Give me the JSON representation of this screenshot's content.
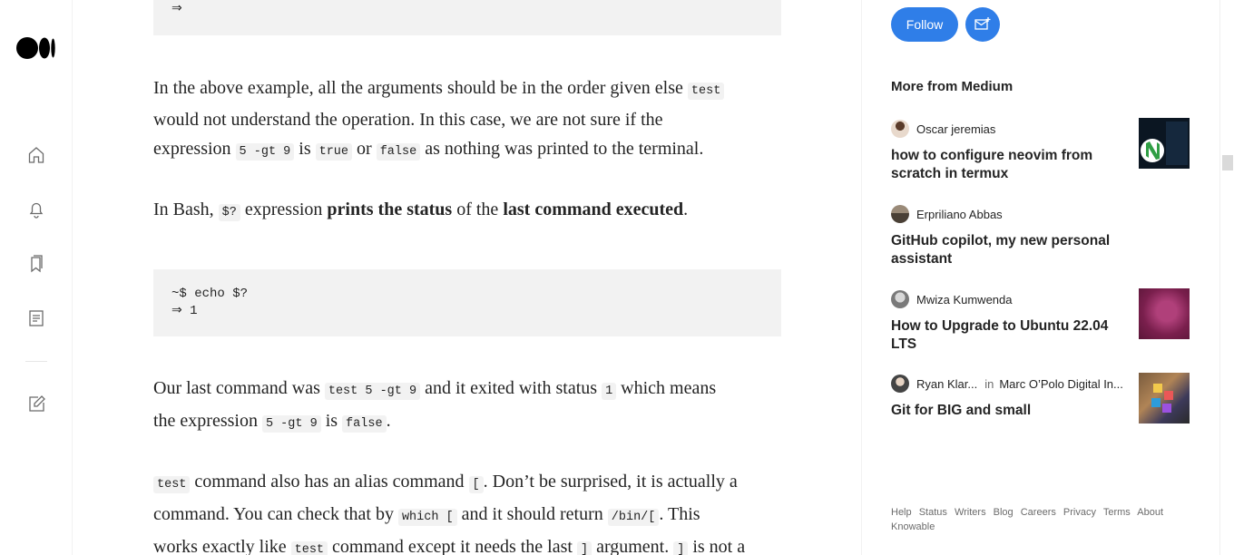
{
  "nav": {
    "icons": [
      "medium-logo",
      "home-icon",
      "notifications-icon",
      "bookmarks-icon",
      "stories-icon",
      "write-icon"
    ]
  },
  "article": {
    "code_top": "⇒",
    "p1_a": "In the above example, all the arguments should be in the order given else ",
    "p1_code": "test",
    "p1_b": "would not understand the operation. In this case, we are not sure if the",
    "p1_c": "expression ",
    "p1_code2": "5 -gt 9",
    "p1_d": " is ",
    "p1_code3": "true",
    "p1_e": " or ",
    "p1_code4": "false",
    "p1_f": " as nothing was printed to the terminal.",
    "p2_a": "In Bash, ",
    "p2_code": "$?",
    "p2_b": " expression ",
    "p2_bold1": "prints the status",
    "p2_c": " of the ",
    "p2_bold2": "last command executed",
    "p2_d": ".",
    "code_mid_1": "~$ echo $?",
    "code_mid_2": "⇒ 1",
    "p3_a": "Our last command was ",
    "p3_code": "test 5 -gt 9",
    "p3_b": " and it exited with status ",
    "p3_code2": "1",
    "p3_c": " which means",
    "p3_d": "the expression ",
    "p3_code3": "5 -gt 9",
    "p3_e": " is ",
    "p3_code4": "false",
    "p3_f": ".",
    "p4_code": "test",
    "p4_a": " command also has an alias command ",
    "p4_code2": "[",
    "p4_b": ". Don’t be surprised, it is actually a",
    "p4_c": "command. You can check that by ",
    "p4_code3": "which [",
    "p4_d": " and it should return ",
    "p4_code4": "/bin/[",
    "p4_e": ". This",
    "p4_f": "works exactly like ",
    "p4_code5": "test",
    "p4_g": " command except it needs the last ",
    "p4_code6": "]",
    "p4_h": " argument. ",
    "p4_code7": "]",
    "p4_i": " is not a"
  },
  "sidebar": {
    "follow_label": "Follow",
    "more_title": "More from Medium",
    "items": [
      {
        "author": "Oscar jeremias",
        "publication": "",
        "title": "how to configure neovim from scratch in termux"
      },
      {
        "author": "Erpriliano Abbas",
        "publication": "",
        "title": "GitHub copilot, my new personal assistant"
      },
      {
        "author": "Mwiza Kumwenda",
        "publication": "",
        "title": "How to Upgrade to Ubuntu 22.04 LTS"
      },
      {
        "author": "Ryan Klar...",
        "in_word": "in",
        "publication": "Marc O’Polo Digital In...",
        "title": "Git for BIG and small"
      }
    ],
    "footer": [
      "Help",
      "Status",
      "Writers",
      "Blog",
      "Careers",
      "Privacy",
      "Terms",
      "About",
      "Knowable"
    ]
  },
  "colors": {
    "accent": "#2f7ee8",
    "code_bg": "#f2f2f2",
    "text": "#242424",
    "muted": "#6b6b6b"
  }
}
